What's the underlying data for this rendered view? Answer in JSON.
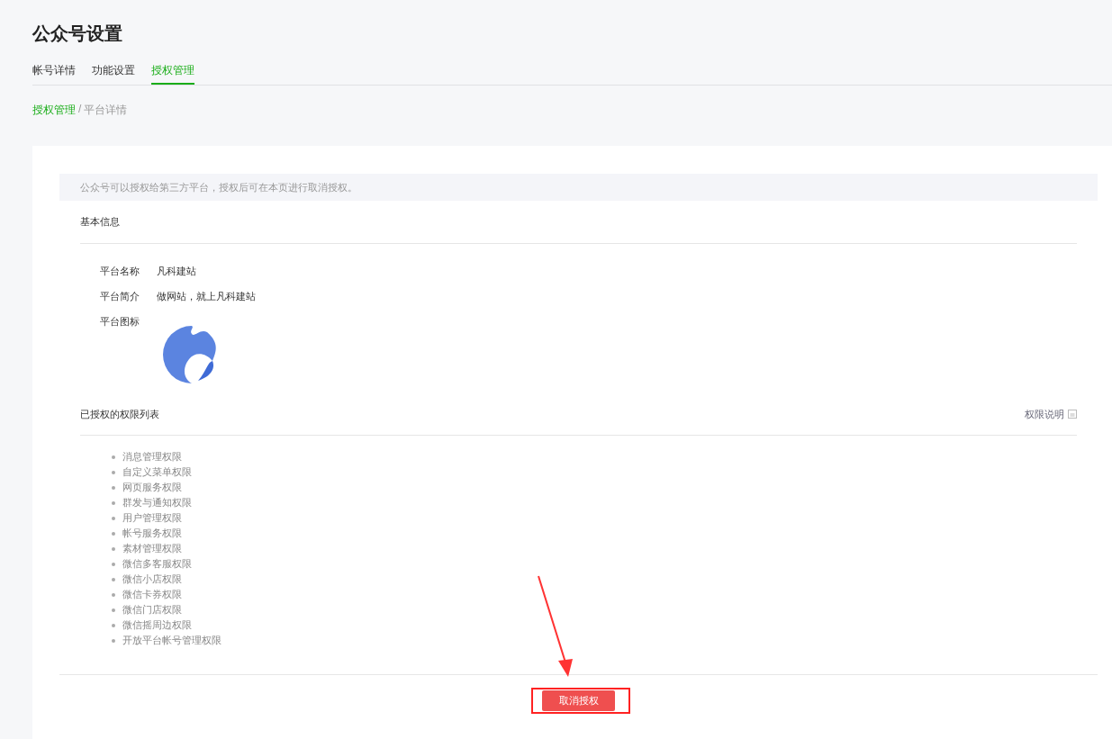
{
  "page_title": "公众号设置",
  "tabs": [
    {
      "label": "帐号详情",
      "selected": false
    },
    {
      "label": "功能设置",
      "selected": false
    },
    {
      "label": "授权管理",
      "selected": true
    }
  ],
  "breadcrumb": {
    "link": "授权管理",
    "separator": "/",
    "current": "平台详情"
  },
  "notice": "公众号可以授权给第三方平台，授权后可在本页进行取消授权。",
  "basic_info": {
    "heading": "基本信息",
    "fields": [
      {
        "label": "平台名称",
        "value": "凡科建站"
      },
      {
        "label": "平台简介",
        "value": "做网站，就上凡科建站"
      }
    ],
    "icon_label": "平台图标"
  },
  "permissions": {
    "heading": "已授权的权限列表",
    "help_link": "权限说明",
    "items": [
      "消息管理权限",
      "自定义菜单权限",
      "网页服务权限",
      "群发与通知权限",
      "用户管理权限",
      "帐号服务权限",
      "素材管理权限",
      "微信多客服权限",
      "微信小店权限",
      "微信卡券权限",
      "微信门店权限",
      "微信摇周边权限",
      "开放平台帐号管理权限"
    ]
  },
  "cancel_button": "取消授权"
}
